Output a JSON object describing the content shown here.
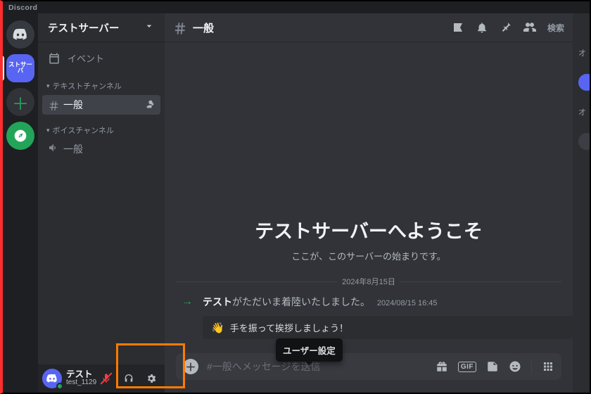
{
  "app_name": "Discord",
  "server": {
    "rail_label": "ストサーバ",
    "name": "テストサーバー",
    "events_label": "イベント",
    "categories": {
      "text": "テキストチャンネル",
      "voice": "ボイスチャンネル"
    },
    "channels": {
      "general_text": "一般",
      "general_voice": "一般"
    }
  },
  "user": {
    "display_name": "テスト",
    "handle": "test_1129"
  },
  "tooltip": {
    "user_settings": "ユーザー設定"
  },
  "chat": {
    "channel_hash": "＃",
    "channel_name": "一般",
    "composer_placeholder": "#一般へメッセージを送信",
    "welcome_title": "テストサーバーへようこそ",
    "welcome_sub": "ここが、このサーバーの始まりです。",
    "date_divider": "2024年8月15日",
    "join_msg": {
      "user": "テスト",
      "text": "がただいま着陸いたしました。",
      "timestamp": "2024/08/15 16:45"
    },
    "wave_button": "手を振って挨拶しましょう！"
  },
  "toolbar": {
    "search_placeholder": "検索"
  },
  "members": {
    "online_label": "オ",
    "offline_label": "オ"
  }
}
